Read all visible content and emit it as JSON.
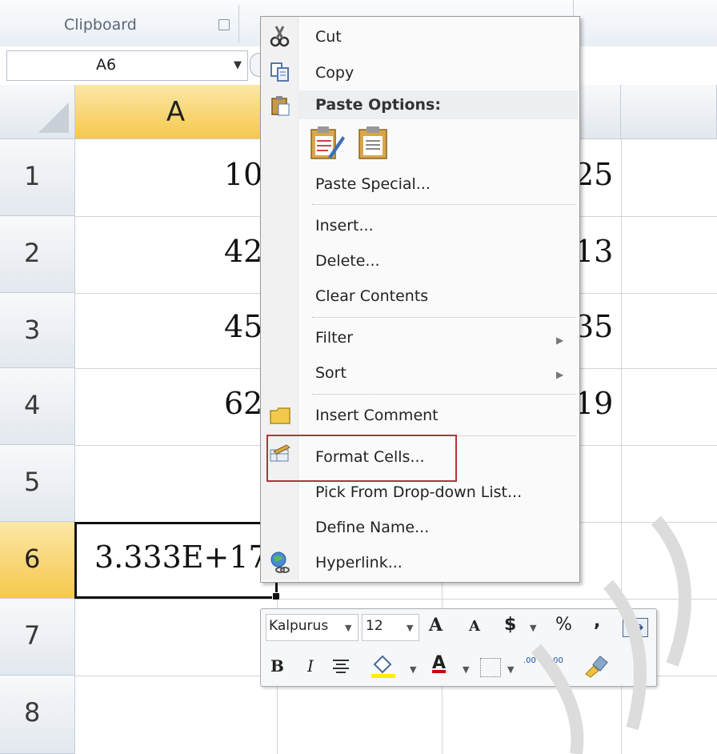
{
  "ribbon": {
    "group_label": "Clipboard"
  },
  "name_box": {
    "value": "A6"
  },
  "columns": {
    "a": "A"
  },
  "rows": [
    "1",
    "2",
    "3",
    "4",
    "5",
    "6",
    "7",
    "8"
  ],
  "cells": {
    "a1": "10",
    "a2": "42",
    "a3": "45",
    "a4": "62",
    "a6": "3.333E+17",
    "c1": "25",
    "c2": "13",
    "c3": "35",
    "c4": "19"
  },
  "context_menu": {
    "cut": "Cut",
    "copy": "Copy",
    "paste_options": "Paste Options:",
    "paste_special": "Paste Special...",
    "insert": "Insert...",
    "delete": "Delete...",
    "clear_contents": "Clear Contents",
    "filter": "Filter",
    "sort": "Sort",
    "insert_comment": "Insert Comment",
    "format_cells": "Format Cells...",
    "pick_list": "Pick From Drop-down List...",
    "define_name": "Define Name...",
    "hyperlink": "Hyperlink..."
  },
  "mini_toolbar": {
    "font": "Kalpurus",
    "size": "12",
    "grow": "A",
    "shrink": "A",
    "currency": "$",
    "percent": "%",
    "comma": ",",
    "bold": "B",
    "italic": "I",
    "font_color": "A",
    "inc_decimal": ".00",
    "dec_decimal": ".00"
  },
  "colors": {
    "highlight_border": "#b3333a",
    "selected_header": "#f6c84d"
  }
}
